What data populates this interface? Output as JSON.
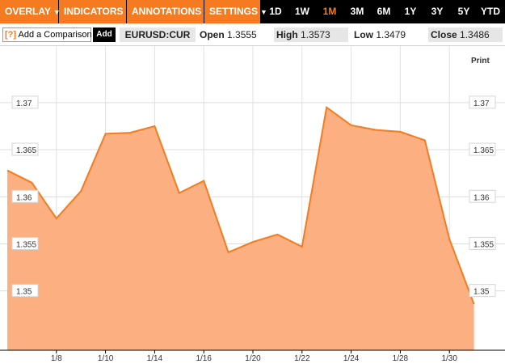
{
  "toolbar": {
    "menus": [
      "OVERLAY",
      "INDICATORS",
      "ANNOTATIONS",
      "SETTINGS"
    ],
    "ranges": [
      "1D",
      "1W",
      "1M",
      "3M",
      "6M",
      "1Y",
      "3Y",
      "5Y",
      "YTD"
    ],
    "active_range": "1M"
  },
  "compare": {
    "help": "[?]",
    "placeholder": "Add a Comparison",
    "add_label": "Add"
  },
  "quote": {
    "symbol": "EURUSD:CUR",
    "open_label": "Open",
    "open": "1.3555",
    "high_label": "High",
    "high": "1.3573",
    "low_label": "Low",
    "low": "1.3479",
    "close_label": "Close",
    "close": "1.3486"
  },
  "print_label": "Print",
  "colors": {
    "accent": "#f47b20",
    "area_fill": "#fcaf80",
    "toolbar_bg": "#000000"
  },
  "chart_data": {
    "type": "area",
    "x": [
      "1/6",
      "1/7",
      "1/8",
      "1/9",
      "1/10",
      "1/11",
      "1/14",
      "1/15",
      "1/16",
      "1/17",
      "1/20",
      "1/21",
      "1/22",
      "1/23",
      "1/24",
      "1/25",
      "1/28",
      "1/29",
      "1/30",
      "1/31"
    ],
    "values": [
      1.3628,
      1.3615,
      1.3577,
      1.3606,
      1.3667,
      1.3668,
      1.3675,
      1.3604,
      1.3617,
      1.3541,
      1.3552,
      1.356,
      1.3547,
      1.3695,
      1.3676,
      1.3671,
      1.3669,
      1.366,
      1.3555,
      1.3486
    ],
    "x_tick_labels": [
      "1/8",
      "1/10",
      "1/14",
      "1/16",
      "1/20",
      "1/22",
      "1/24",
      "1/28",
      "1/30"
    ],
    "y_ticks": [
      1.35,
      1.355,
      1.36,
      1.365,
      1.37
    ],
    "ylim": [
      1.3437,
      1.376
    ],
    "grid": true
  }
}
